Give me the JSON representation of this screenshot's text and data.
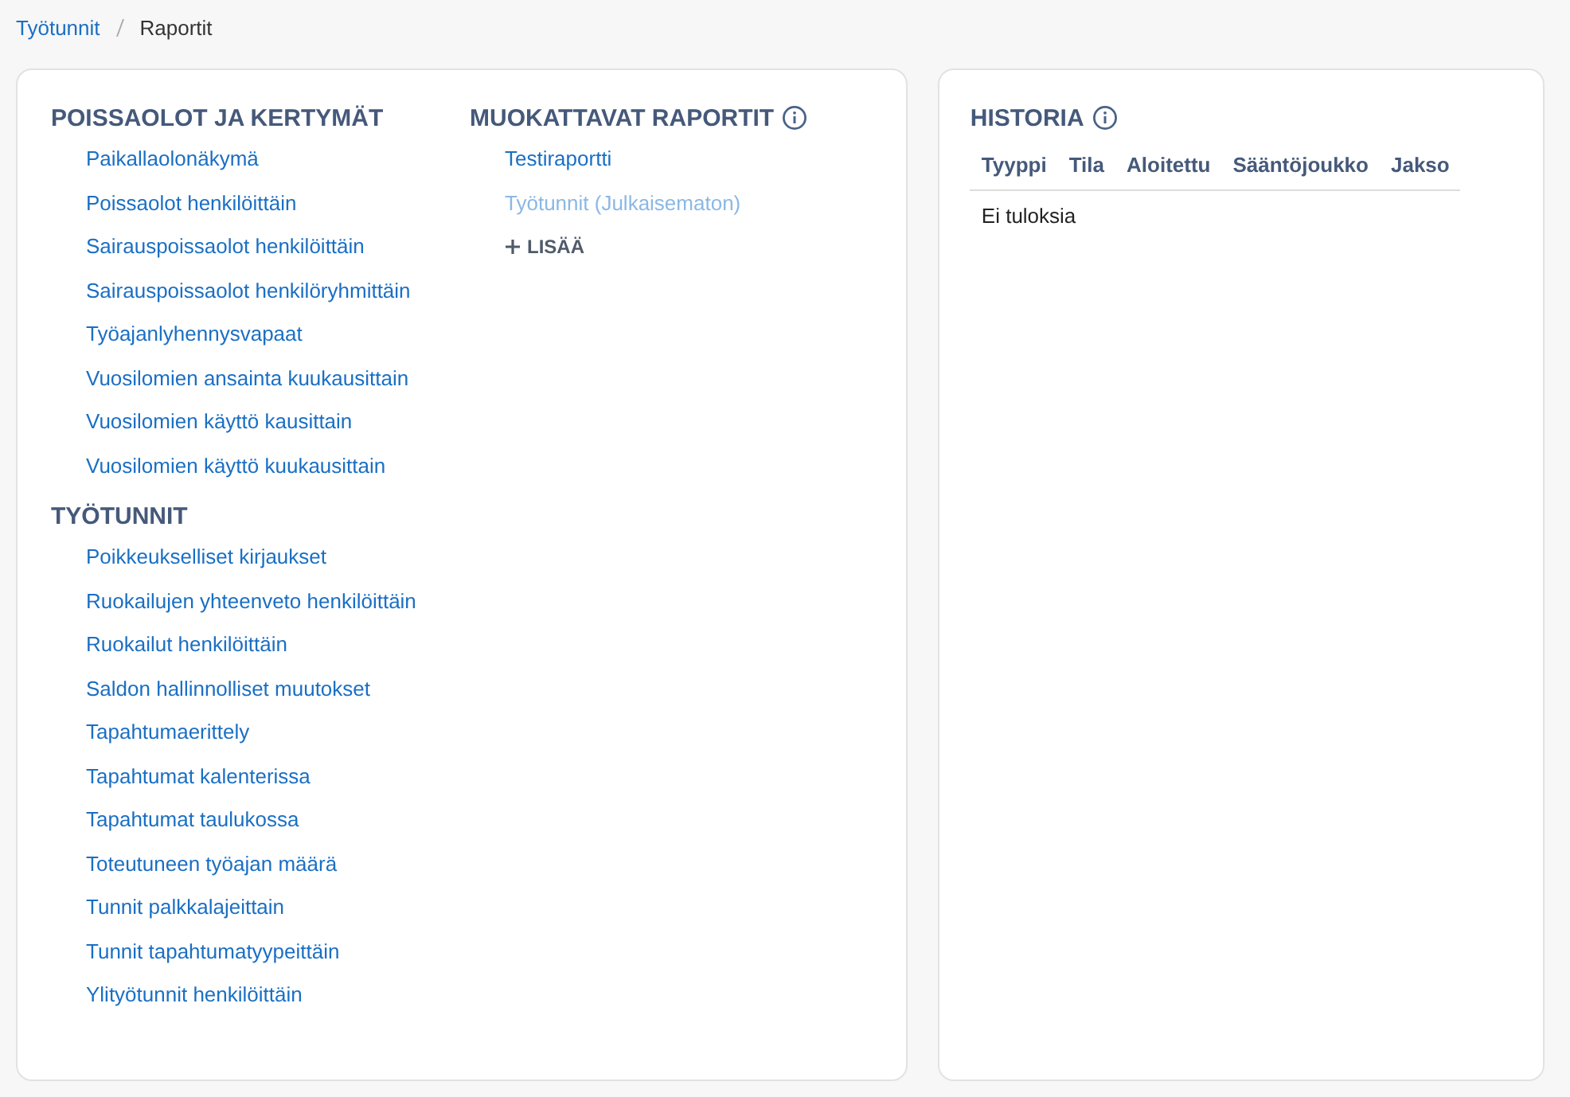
{
  "breadcrumb": [
    {
      "label": "Työtunnit",
      "link": true
    },
    {
      "label": "Raportit",
      "link": false
    }
  ],
  "report_columns": [
    {
      "sections": [
        {
          "title": "POISSAOLOT JA KERTYMÄT",
          "items": [
            {
              "label": "Paikallaolonäkymä",
              "published": true
            },
            {
              "label": "Poissaolot henkilöittäin",
              "published": true
            },
            {
              "label": "Sairauspoissaolot henkilöittäin",
              "published": true
            },
            {
              "label": "Sairauspoissaolot henkilöryhmittäin",
              "published": true
            },
            {
              "label": "Työajanlyhennysvapaat",
              "published": true
            },
            {
              "label": "Vuosilomien ansainta kuukausittain",
              "published": true
            },
            {
              "label": "Vuosilomien käyttö kausittain",
              "published": true
            },
            {
              "label": "Vuosilomien käyttö kuukausittain",
              "published": true
            }
          ]
        },
        {
          "title": "TYÖTUNNIT",
          "items": [
            {
              "label": "Poikkeukselliset kirjaukset",
              "published": true
            },
            {
              "label": "Ruokailujen yhteenveto henkilöittäin",
              "published": true
            },
            {
              "label": "Ruokailut henkilöittäin",
              "published": true
            },
            {
              "label": "Saldon hallinnolliset muutokset",
              "published": true
            },
            {
              "label": "Tapahtumaerittely",
              "published": true
            },
            {
              "label": "Tapahtumat kalenterissa",
              "published": true
            },
            {
              "label": "Tapahtumat taulukossa",
              "published": true
            },
            {
              "label": "Toteutuneen työajan määrä",
              "published": true
            },
            {
              "label": "Tunnit palkkalajeittain",
              "published": true
            },
            {
              "label": "Tunnit tapahtumatyypeittäin",
              "published": true
            },
            {
              "label": "Ylityötunnit henkilöittäin",
              "published": true
            }
          ]
        }
      ]
    },
    {
      "sections": [
        {
          "title": "MUOKATTAVAT RAPORTIT",
          "info": true,
          "items": [
            {
              "label": "Testiraportti",
              "published": true
            },
            {
              "label": "Työtunnit (Julkaisematon)",
              "published": false
            }
          ],
          "add_button": "LISÄÄ"
        }
      ]
    }
  ],
  "history": {
    "title": "HISTORIA",
    "info": true,
    "columns": [
      "Tyyppi",
      "Tila",
      "Aloitettu",
      "Sääntöjoukko",
      "Jakso"
    ],
    "empty_text": "Ei tuloksia"
  }
}
